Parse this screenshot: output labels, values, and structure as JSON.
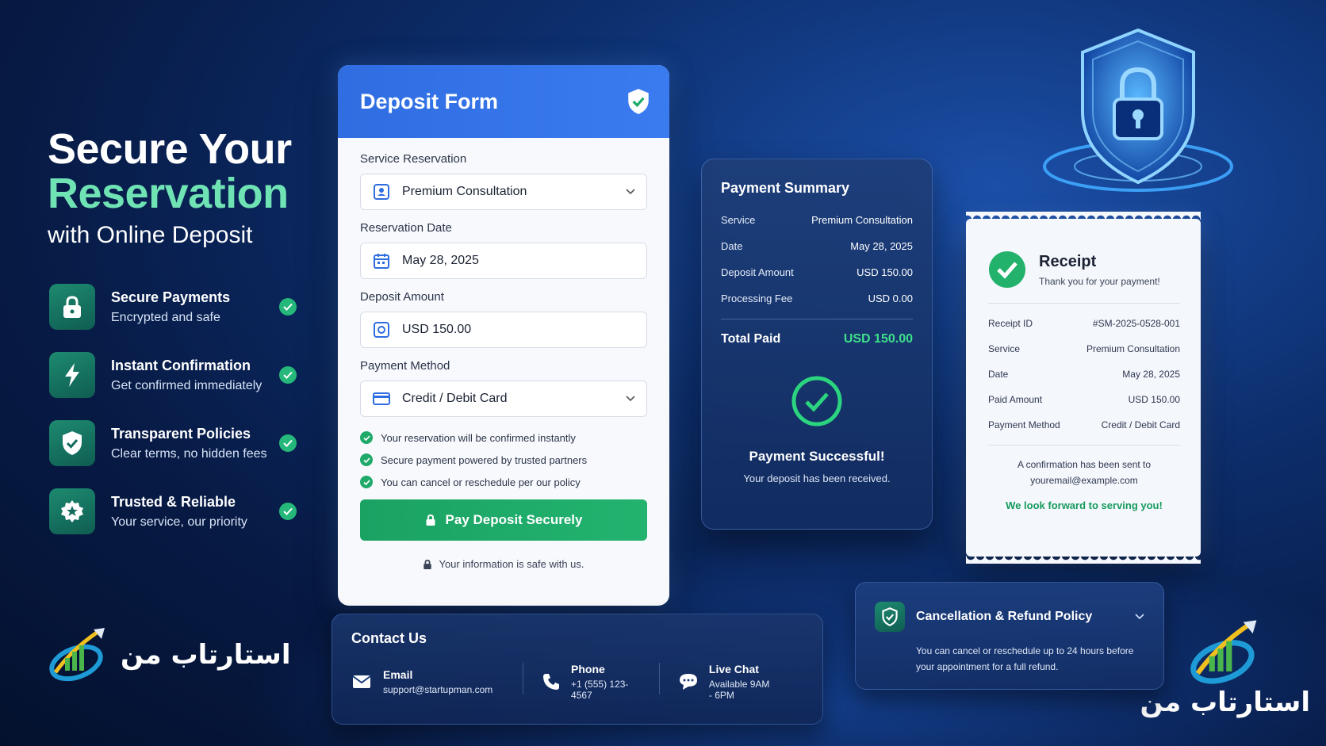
{
  "hero": {
    "title_line1": "Secure Your",
    "title_line2": "Reservation",
    "subtitle": "with Online Deposit"
  },
  "features": [
    {
      "icon": "lock-icon",
      "title": "Secure Payments",
      "desc": "Encrypted and safe"
    },
    {
      "icon": "lightning-icon",
      "title": "Instant Confirmation",
      "desc": "Get confirmed immediately"
    },
    {
      "icon": "shield-check-icon",
      "title": "Transparent Policies",
      "desc": "Clear terms, no hidden fees"
    },
    {
      "icon": "star-badge-icon",
      "title": "Trusted & Reliable",
      "desc": "Your service, our priority"
    }
  ],
  "brand": {
    "name": "استارتاب من"
  },
  "deposit_form": {
    "title": "Deposit Form",
    "service_label": "Service Reservation",
    "service_value": "Premium Consultation",
    "date_label": "Reservation Date",
    "date_value": "May 28, 2025",
    "amount_label": "Deposit Amount",
    "amount_value": "USD 150.00",
    "method_label": "Payment Method",
    "method_value": "Credit / Debit Card",
    "checks": [
      "Your reservation will be confirmed instantly",
      "Secure payment powered by trusted partners",
      "You can cancel or reschedule per our policy"
    ],
    "pay_button": "Pay Deposit Securely",
    "safe_note": "Your information is safe with us."
  },
  "summary": {
    "title": "Payment Summary",
    "rows": [
      {
        "label": "Service",
        "value": "Premium Consultation"
      },
      {
        "label": "Date",
        "value": "May 28, 2025"
      },
      {
        "label": "Deposit Amount",
        "value": "USD 150.00"
      },
      {
        "label": "Processing Fee",
        "value": "USD 0.00"
      }
    ],
    "total_label": "Total Paid",
    "total_value": "USD 150.00",
    "success_title": "Payment Successful!",
    "success_desc": "Your deposit has been received."
  },
  "receipt": {
    "title": "Receipt",
    "subtitle": "Thank you for your payment!",
    "rows": [
      {
        "label": "Receipt ID",
        "value": "#SM-2025-0528-001"
      },
      {
        "label": "Service",
        "value": "Premium Consultation"
      },
      {
        "label": "Date",
        "value": "May 28, 2025"
      },
      {
        "label": "Paid Amount",
        "value": "USD 150.00"
      },
      {
        "label": "Payment Method",
        "value": "Credit / Debit Card"
      }
    ],
    "note_line1": "A confirmation has been sent to",
    "note_line2": "youremail@example.com",
    "thanks": "We look forward to serving you!"
  },
  "contact": {
    "title": "Contact Us",
    "items": [
      {
        "icon": "mail-icon",
        "label": "Email",
        "value": "support@startupman.com"
      },
      {
        "icon": "phone-icon",
        "label": "Phone",
        "value": "+1 (555) 123-4567"
      },
      {
        "icon": "chat-icon",
        "label": "Live Chat",
        "value": "Available 9AM - 6PM"
      }
    ]
  },
  "policy": {
    "title": "Cancellation & Refund Policy",
    "text_line1": "You can cancel or reschedule up to 24 hours before",
    "text_line2": "your appointment for a full refund."
  },
  "colors": {
    "accent_green": "#23b36f",
    "hero_accent": "#6fe3b4",
    "form_header_blue": "#2f6de1",
    "total_green": "#3ee08b"
  }
}
